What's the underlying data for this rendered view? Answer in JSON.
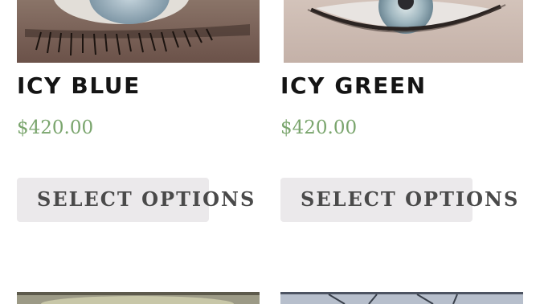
{
  "products": [
    {
      "image_icon": "eye-photo-icon",
      "title": "ICY BLUE",
      "price": "$420.00",
      "button_label": "SELECT OPTIONS"
    },
    {
      "image_icon": "eye-photo-icon",
      "title": "ICY GREEN",
      "price": "$420.00",
      "button_label": "SELECT OPTIONS"
    }
  ],
  "colors": {
    "price": "#7aa56d",
    "button_bg": "#ebe9eb",
    "button_text": "#4a4a4a",
    "title": "#141414"
  }
}
